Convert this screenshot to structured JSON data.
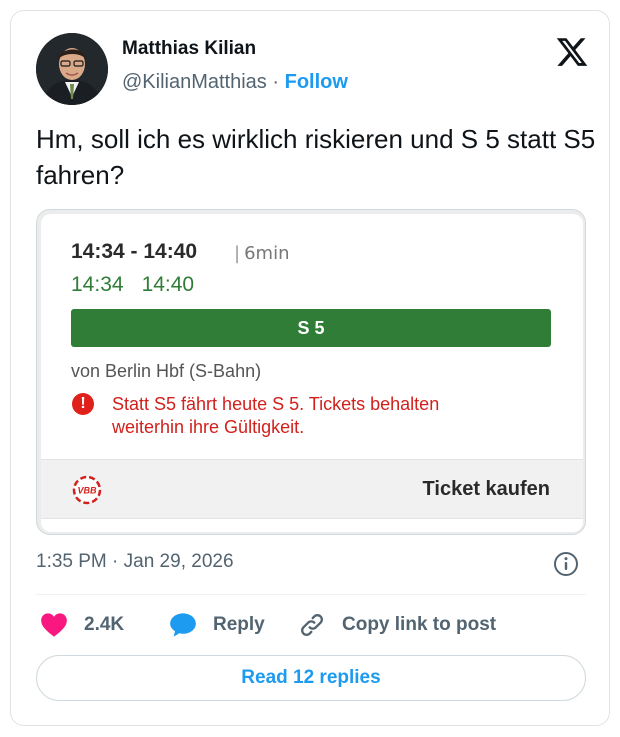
{
  "author": {
    "name": "Matthias Kilian",
    "handle": "@KilianMatthias",
    "separator": "·",
    "follow_label": "Follow"
  },
  "tweet": {
    "text": "Hm, soll ich es wirklich riskieren und S 5 statt S5 fahren?",
    "timestamp": "1:35 PM · Jan 29, 2026"
  },
  "media": {
    "times_planned": "14:34 - 14:40",
    "duration_separator": "|",
    "duration": "6min",
    "realtime_departure": "14:34",
    "realtime_arrival": "14:40",
    "line_label": "S 5",
    "station": "von Berlin Hbf (S-Bahn)",
    "alert_icon_glyph": "!",
    "alert_text": "Statt S5 fährt heute S 5. Tickets behalten weiterhin ihre Gültigkeit.",
    "vbb_logo_text": "VBB",
    "ticket_label": "Ticket kaufen"
  },
  "actions": {
    "like_count": "2.4K",
    "reply_label": "Reply",
    "copy_label": "Copy link to post"
  },
  "read_replies_label": "Read 12 replies",
  "icons": {
    "logo": "x-logo-icon",
    "like": "heart-icon",
    "reply": "speech-bubble-icon",
    "copy": "link-icon",
    "info": "info-icon"
  },
  "colors": {
    "link_blue": "#1d9bf0",
    "like_pink": "#f91880",
    "line_green": "#2f7d36",
    "alert_red": "#d2201c",
    "muted_text": "#536471"
  }
}
